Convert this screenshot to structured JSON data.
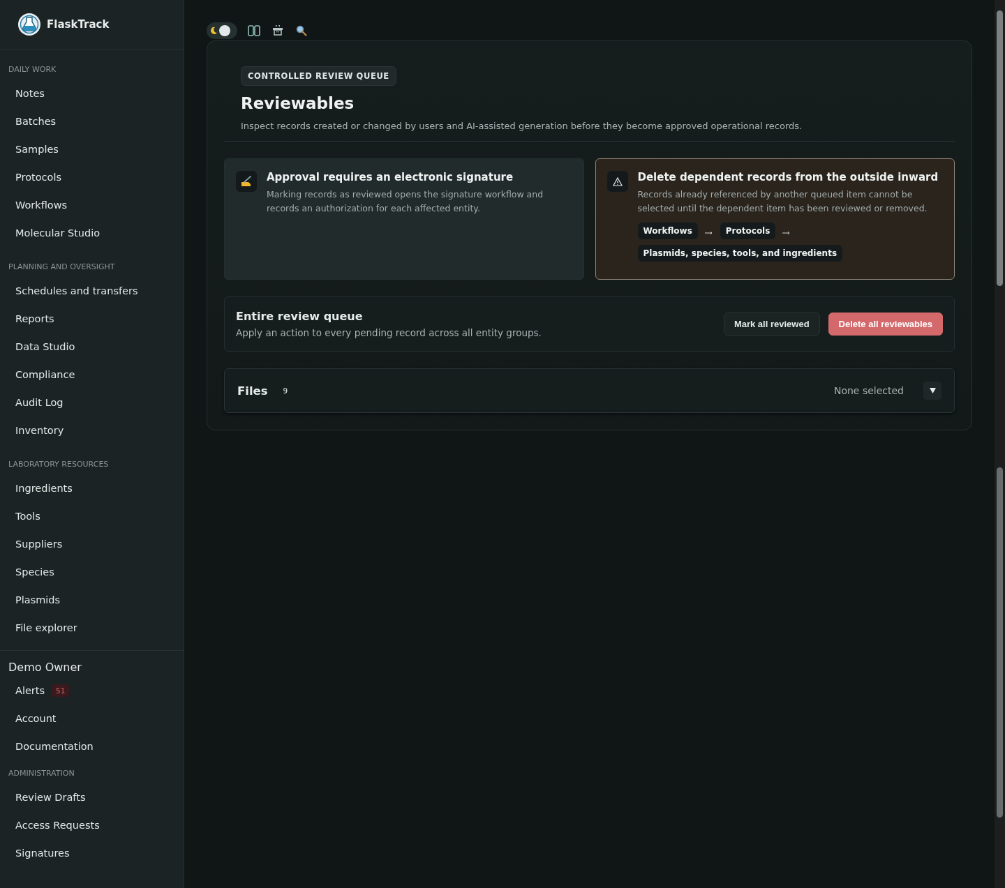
{
  "brand": {
    "name": "FlaskTrack"
  },
  "sidebar": {
    "sections": [
      {
        "heading": "DAILY WORK",
        "items": [
          {
            "label": "Notes"
          },
          {
            "label": "Batches"
          },
          {
            "label": "Samples"
          },
          {
            "label": "Protocols"
          },
          {
            "label": "Workflows"
          },
          {
            "label": "Molecular Studio"
          }
        ]
      },
      {
        "heading": "PLANNING AND OVERSIGHT",
        "items": [
          {
            "label": "Schedules and transfers"
          },
          {
            "label": "Reports"
          },
          {
            "label": "Data Studio"
          },
          {
            "label": "Compliance"
          },
          {
            "label": "Audit Log"
          },
          {
            "label": "Inventory"
          }
        ]
      },
      {
        "heading": "LABORATORY RESOURCES",
        "items": [
          {
            "label": "Ingredients"
          },
          {
            "label": "Tools"
          },
          {
            "label": "Suppliers"
          },
          {
            "label": "Species"
          },
          {
            "label": "Plasmids"
          },
          {
            "label": "File explorer"
          }
        ]
      }
    ],
    "user": {
      "name": "Demo Owner",
      "items": [
        {
          "label": "Alerts",
          "badge": "51"
        },
        {
          "label": "Account"
        },
        {
          "label": "Documentation"
        }
      ]
    },
    "admin": {
      "heading": "ADMINISTRATION",
      "items": [
        {
          "label": "Review Drafts"
        },
        {
          "label": "Access Requests"
        },
        {
          "label": "Signatures"
        }
      ]
    }
  },
  "toolbar": {
    "dark_mode": true
  },
  "header": {
    "eyebrow": "CONTROLLED REVIEW QUEUE",
    "title": "Reviewables",
    "description": "Inspect records created or changed by users and AI-assisted generation before they become approved operational records."
  },
  "notices": [
    {
      "kind": "info",
      "title": "Approval requires an electronic signature",
      "text": "Marking records as reviewed opens the signature workflow and records an authorization for each affected entity."
    },
    {
      "kind": "warning",
      "title": "Delete dependent records from the outside inward",
      "text": "Records already referenced by another queued item cannot be selected until the dependent item has been reviewed or removed.",
      "chain": [
        "Workflows",
        "Protocols",
        "Plasmids, species, tools, and ingredients"
      ]
    }
  ],
  "queue": {
    "title": "Entire review queue",
    "text": "Apply an action to every pending record across all entity groups.",
    "buttons": [
      {
        "kind": "secondary",
        "label": "Mark all reviewed"
      },
      {
        "kind": "danger",
        "label": "Delete all reviewables"
      }
    ]
  },
  "groups": [
    {
      "title": "Files",
      "count": "9",
      "selection": "None selected",
      "expanded": false
    }
  ]
}
